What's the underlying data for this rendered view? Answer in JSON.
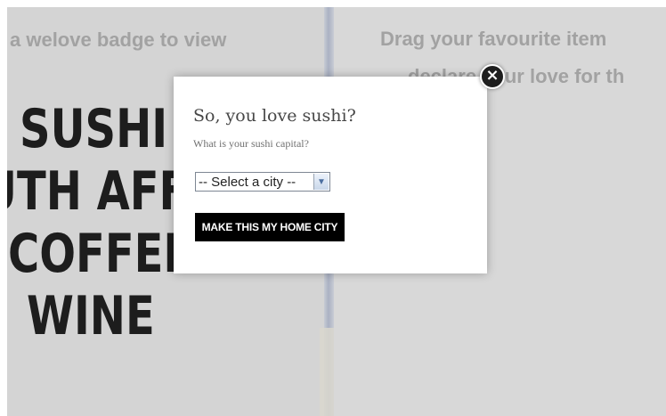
{
  "background": {
    "left_panel": {
      "badge_text": "a welove badge to view",
      "food_items": [
        "SUSHI",
        "UTH AFF",
        "COFFEE",
        "WINE"
      ]
    },
    "right_panel": {
      "line1": "Drag your favourite item",
      "line2": "declare your love for th"
    }
  },
  "modal": {
    "title": "So, you love sushi?",
    "question": "What is your sushi capital?",
    "city_select": {
      "selected": "-- Select a city --"
    },
    "button_label": "MAKE THIS MY HOME CITY",
    "close_icon": "close-icon"
  },
  "colors": {
    "overlay": "#d7d7d7",
    "button_bg": "#000000",
    "button_text": "#ffffff",
    "close_bg": "#1e1e1e",
    "food_text": "#1d1d1d",
    "faded_text": "#a2a2a2"
  }
}
